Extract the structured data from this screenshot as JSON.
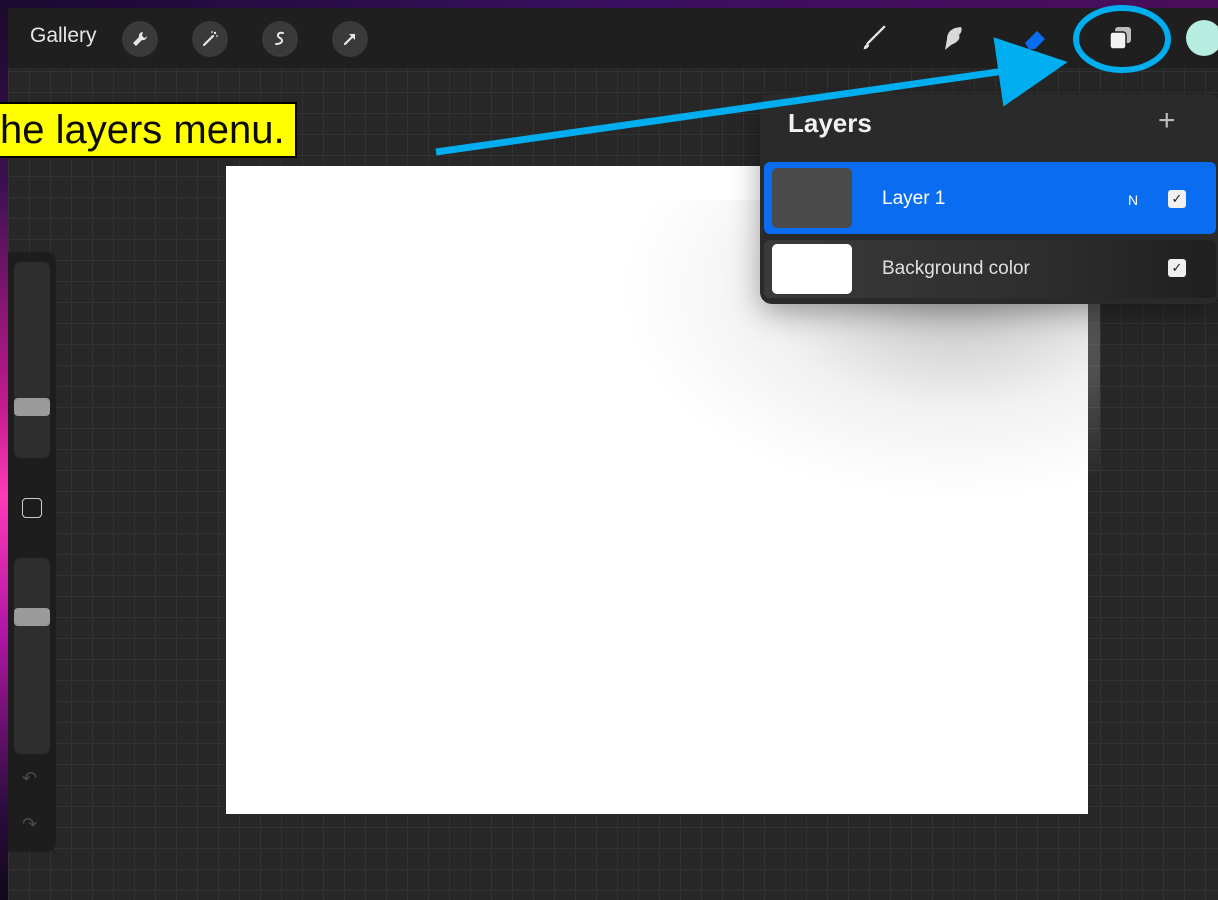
{
  "toolbar": {
    "gallery_label": "Gallery",
    "left_tools": [
      "wrench-icon",
      "magic-wand-icon",
      "selection-icon",
      "transform-arrow-icon"
    ],
    "right_tools": [
      "brush-icon",
      "smudge-icon",
      "eraser-icon",
      "layers-icon"
    ],
    "current_color": "#b7ece0"
  },
  "callout": {
    "text": "he layers menu."
  },
  "layers": {
    "title": "Layers",
    "add_label": "+",
    "items": [
      {
        "name": "Layer 1",
        "mode": "N",
        "visible": true,
        "selected": true,
        "thumb_color": "#4a4a4a"
      },
      {
        "name": "Background color",
        "mode": "",
        "visible": true,
        "selected": false,
        "thumb_color": "#ffffff"
      }
    ]
  },
  "colors": {
    "accent": "#0a6cf0",
    "annotation_blue": "#00aeef",
    "highlight_yellow": "#ffff00"
  }
}
